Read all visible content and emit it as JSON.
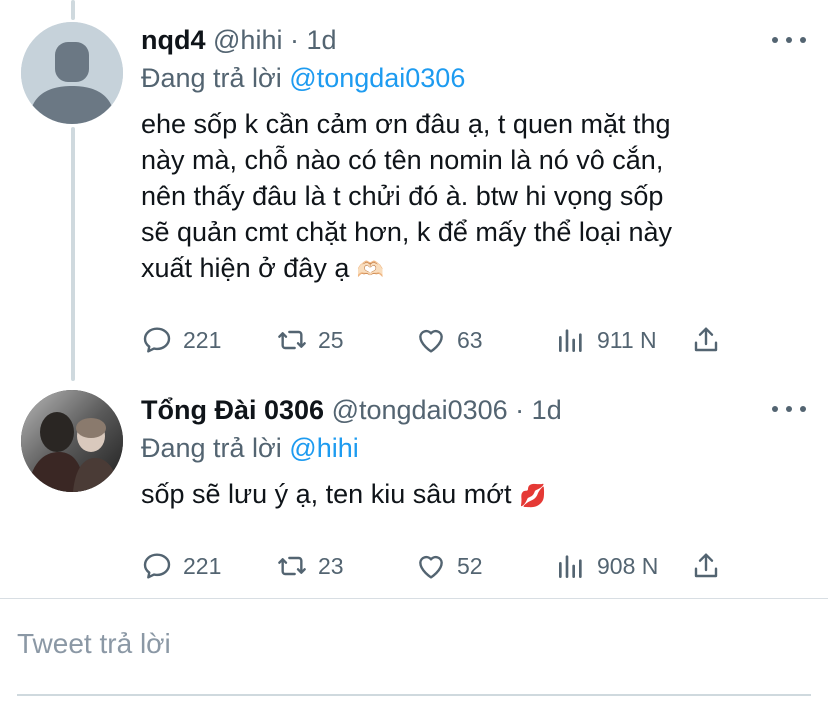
{
  "tweets": [
    {
      "display_name": "nqd4",
      "handle": "@hihi",
      "time": "1d",
      "reply_prefix": "Đang trả lời",
      "reply_to": "@tongdai0306",
      "body_lines": [
        "ehe sốp k cần cảm ơn đâu ạ, t quen mặt thg",
        "này mà, chỗ nào có tên nomin là nó vô cắn,",
        "nên thấy đâu là t chửi đó à. btw hi vọng sốp",
        "sẽ quản cmt chặt hơn, k để mấy thể loại này",
        "xuất hiện ở đây ạ"
      ],
      "emoji": "🫶🏻",
      "replies": "221",
      "retweets": "25",
      "likes": "63",
      "views": "911 N",
      "avatar": "default-avatar"
    },
    {
      "display_name": "Tổng Đài 0306",
      "handle": "@tongdai0306",
      "time": "1d",
      "reply_prefix": "Đang trả lời",
      "reply_to": "@hihi",
      "body_lines": [
        "sốp sẽ lưu ý ạ, ten kiu sâu mớt"
      ],
      "emoji": "💋",
      "replies": "221",
      "retweets": "23",
      "likes": "52",
      "views": "908 N",
      "avatar": "photo-avatar"
    }
  ],
  "separator": "·",
  "reply_placeholder": "Tweet trả lời",
  "colors": {
    "text": "#0f1419",
    "secondary": "#536471",
    "link": "#1d9bf0",
    "thread_line": "#cfd9de",
    "divider": "#d8dee3"
  },
  "icons": [
    "reply-icon",
    "retweet-icon",
    "like-icon",
    "views-icon",
    "share-icon",
    "more-icon"
  ]
}
